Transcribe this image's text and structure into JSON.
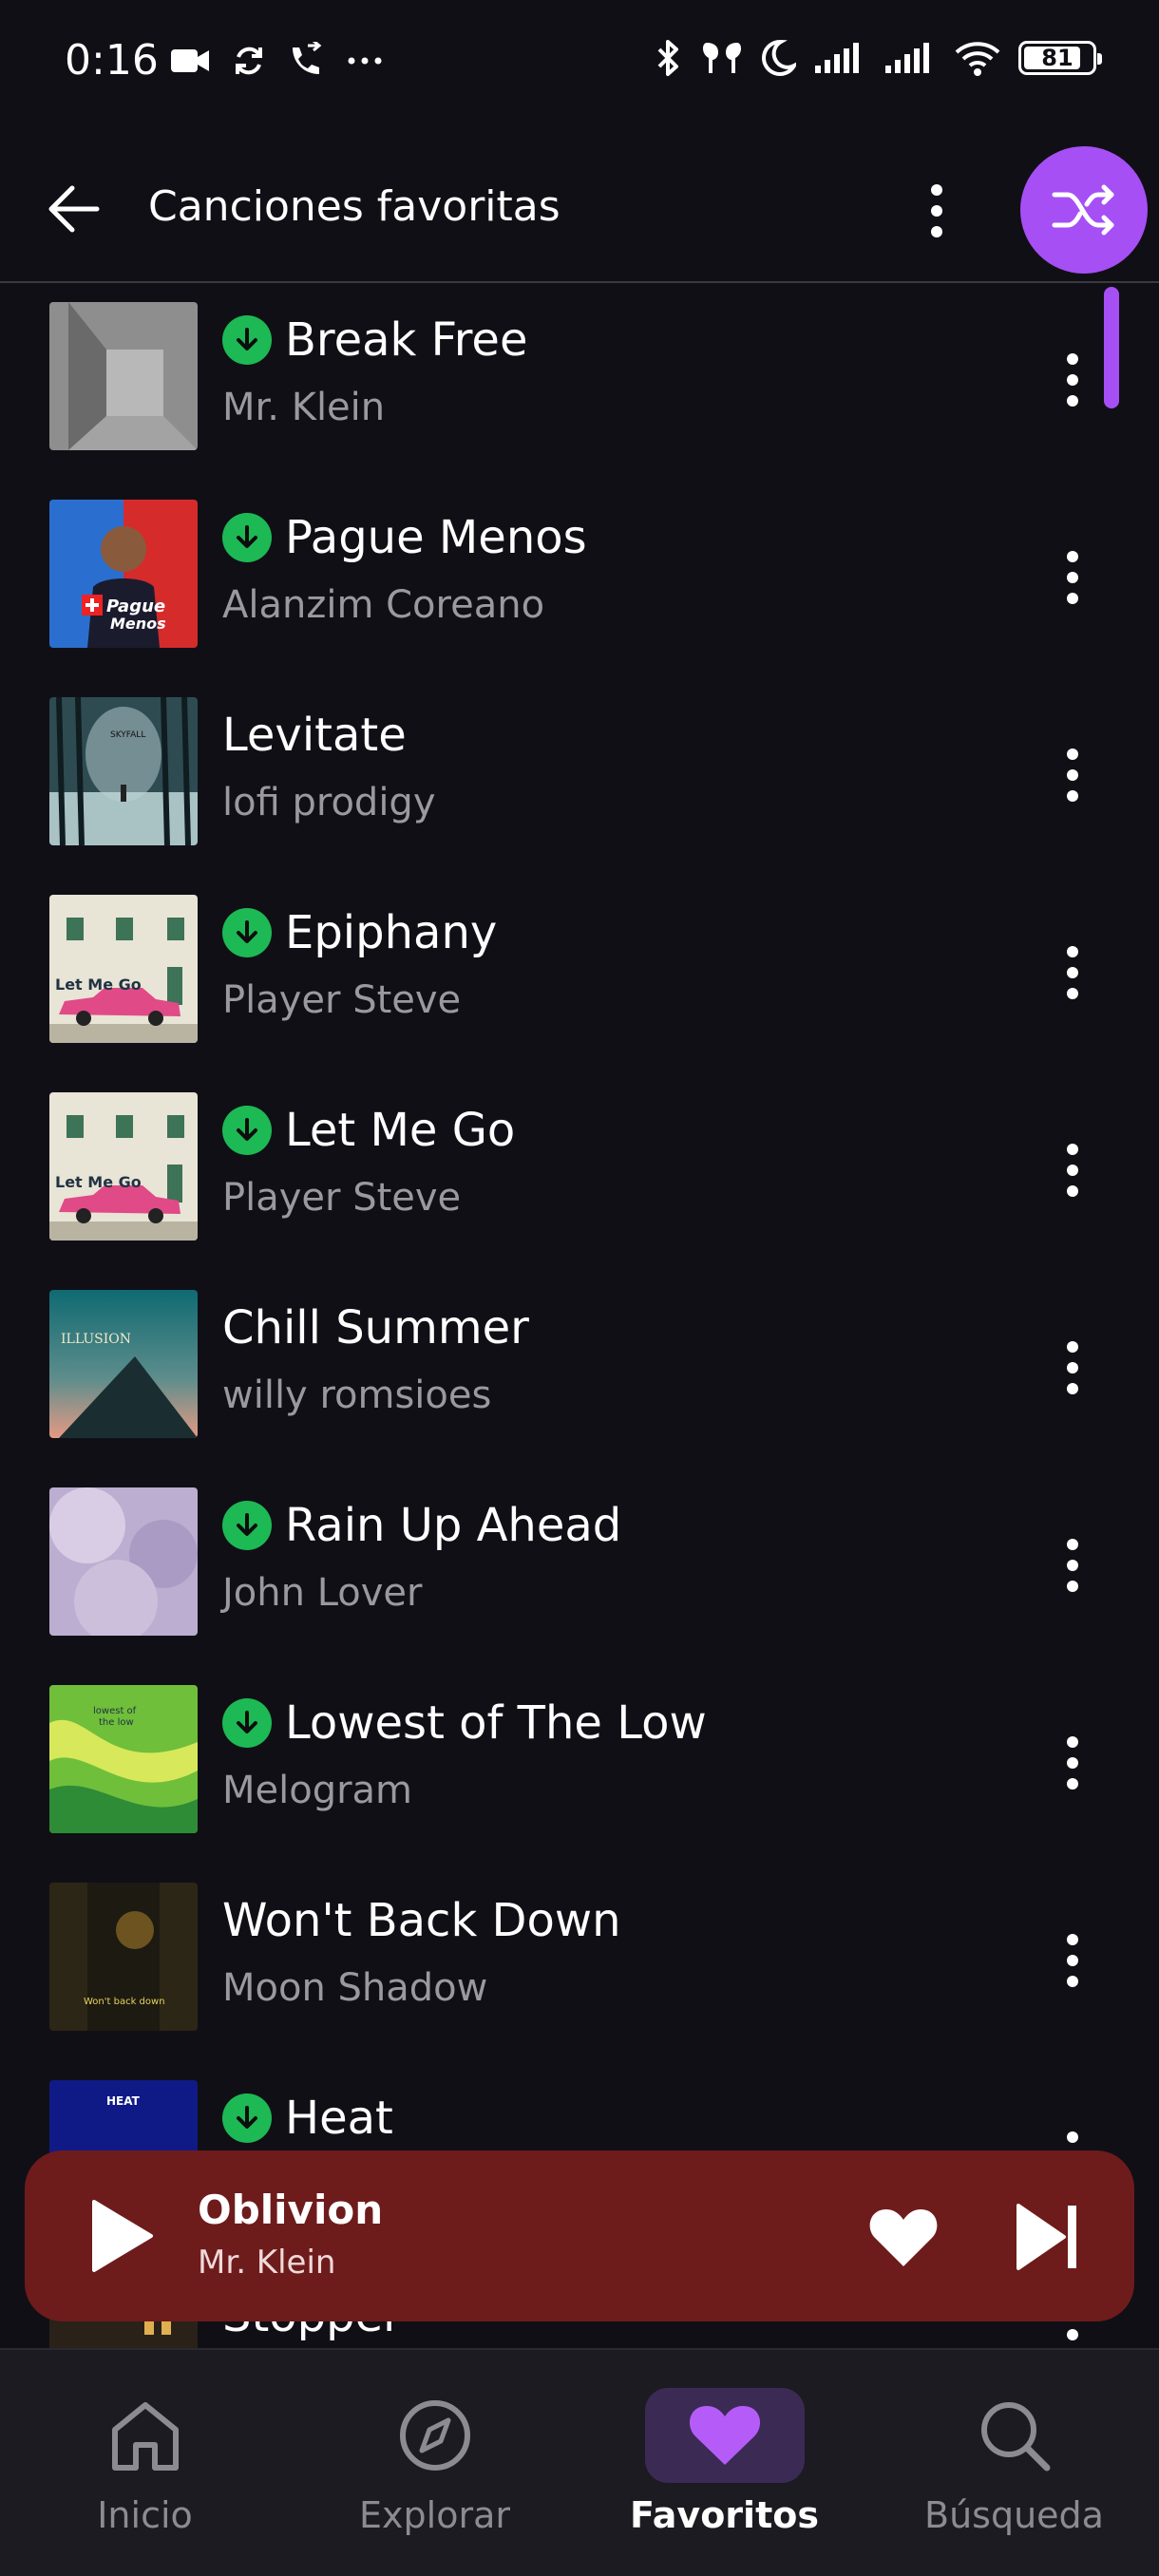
{
  "status_bar": {
    "time": "0:16",
    "battery": "81"
  },
  "header": {
    "title": "Canciones favoritas"
  },
  "songs": [
    {
      "title": "Break Free",
      "artist": "Mr. Klein",
      "downloaded": true,
      "cover": "gray"
    },
    {
      "title": "Pague Menos",
      "artist": "Alanzim Coreano",
      "downloaded": true,
      "cover": "red-blue",
      "cover_text": "Pague Menos"
    },
    {
      "title": "Levitate",
      "artist": "lofi prodigy",
      "downloaded": false,
      "cover": "forest",
      "cover_text": "SKYFALL"
    },
    {
      "title": "Epiphany",
      "artist": "Player Steve",
      "downloaded": true,
      "cover": "car",
      "cover_text": "Let Me Go"
    },
    {
      "title": "Let Me Go",
      "artist": "Player Steve",
      "downloaded": true,
      "cover": "car",
      "cover_text": "Let Me Go"
    },
    {
      "title": "Chill Summer",
      "artist": "willy romsioes",
      "downloaded": false,
      "cover": "illusion",
      "cover_text": "ILLUSION"
    },
    {
      "title": "Rain Up Ahead",
      "artist": "John Lover",
      "downloaded": true,
      "cover": "pastel"
    },
    {
      "title": "Lowest of The Low",
      "artist": "Melogram",
      "downloaded": true,
      "cover": "green",
      "cover_text": "lowest of the low"
    },
    {
      "title": "Won't Back Down",
      "artist": "Moon Shadow",
      "downloaded": false,
      "cover": "alley",
      "cover_text": "Won't back down"
    },
    {
      "title": "Heat",
      "artist": "",
      "downloaded": true,
      "cover": "blue",
      "cover_text": "HEAT"
    },
    {
      "title": "Stopper",
      "artist": "",
      "downloaded": false,
      "cover": "dark"
    }
  ],
  "mini_player": {
    "title": "Oblivion",
    "artist": "Mr. Klein"
  },
  "nav": [
    {
      "label": "Inicio",
      "icon": "home-icon",
      "active": false
    },
    {
      "label": "Explorar",
      "icon": "compass-icon",
      "active": false
    },
    {
      "label": "Favoritos",
      "icon": "heart-icon",
      "active": true
    },
    {
      "label": "Búsqueda",
      "icon": "search-icon",
      "active": false
    }
  ],
  "colors": {
    "background": "#110f16",
    "accent": "#a64ff5",
    "download": "#1db954",
    "player": "#6e1b1c",
    "nav": "#1c1b22"
  }
}
